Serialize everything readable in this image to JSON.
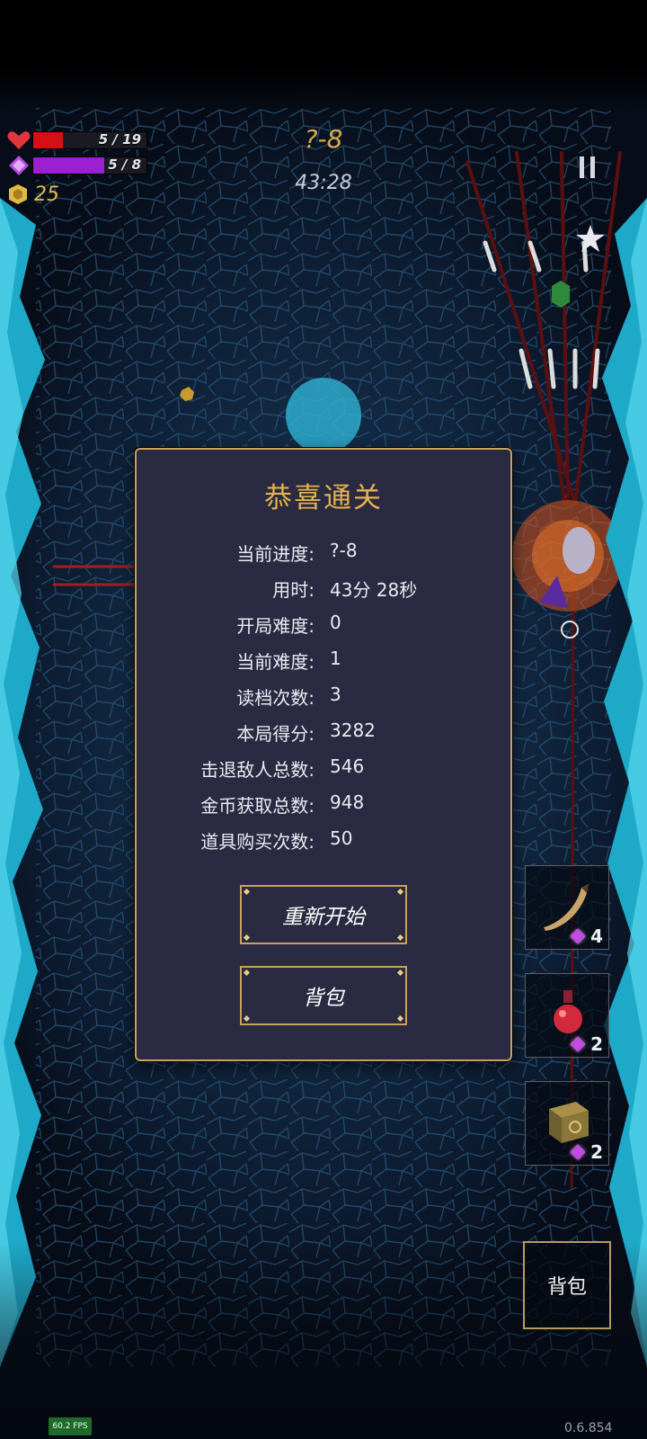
{
  "hud": {
    "hp_text": "5 / 19",
    "hp_fraction": 0.263,
    "mana_text": "5 / 8",
    "mana_fraction": 0.625,
    "gold": "25",
    "stage": "?-8",
    "timer": "43:28"
  },
  "dialog": {
    "title": "恭喜通关",
    "stats": [
      {
        "label": "当前进度:",
        "value": "?-8"
      },
      {
        "label": "用时:",
        "value": "43分 28秒"
      },
      {
        "label": "开局难度:",
        "value": "0"
      },
      {
        "label": "当前难度:",
        "value": "1"
      },
      {
        "label": "读档次数:",
        "value": "3"
      },
      {
        "label": "本局得分:",
        "value": "3282"
      },
      {
        "label": "击退敌人总数:",
        "value": "546"
      },
      {
        "label": "金币获取总数:",
        "value": "948"
      },
      {
        "label": "道具购买次数:",
        "value": "50"
      }
    ],
    "restart_label": "重新开始",
    "bag_label": "背包"
  },
  "items": [
    {
      "icon": "horn-icon",
      "count": "4"
    },
    {
      "icon": "potion-icon",
      "count": "2"
    },
    {
      "icon": "rune-box-icon",
      "count": "2"
    }
  ],
  "side_bag_label": "背包",
  "fps": "60.2 FPS",
  "version": "0.6.854",
  "colors": {
    "hp": "#d60f16",
    "mana": "#9d1fd4",
    "gold": "#e0b84a",
    "accent_border": "#c7a45c",
    "dialog_bg": "#2a2a42",
    "title": "#e3b24c"
  }
}
